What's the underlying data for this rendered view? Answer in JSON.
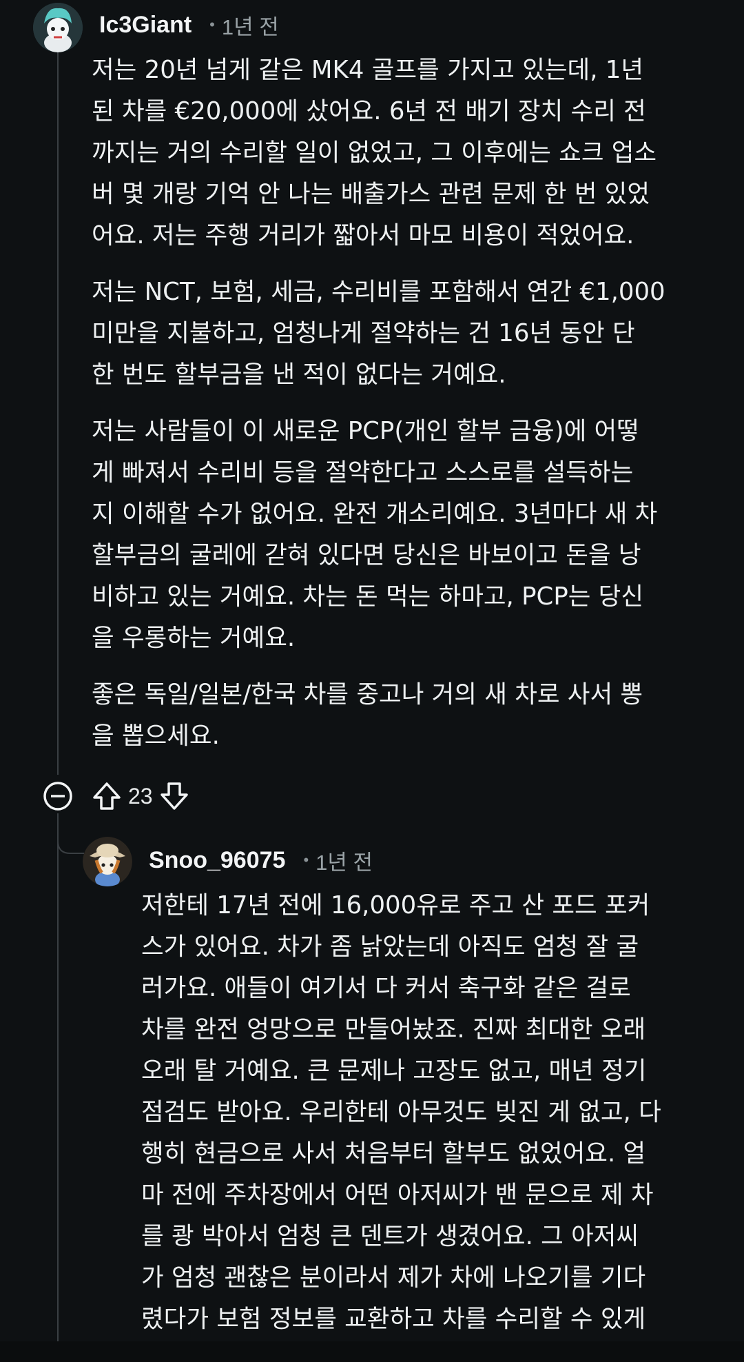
{
  "comments": [
    {
      "author": "Ic3Giant",
      "age": "1년 전",
      "paragraphs": [
        [
          "저는 20년 넘게 같은 MK4 골프를 가지고 있는데, 1년",
          "된 차를 €20,000에 샀어요. 6년 전 배기 장치 수리 전",
          "까지는 거의 수리할 일이 없었고, 그 이후에는 쇼크 업소",
          "버 몇 개랑 기억 안 나는 배출가스 관련 문제 한 번 있었",
          "어요. 저는 주행 거리가 짧아서 마모 비용이 적었어요."
        ],
        [
          "저는 NCT, 보험, 세금, 수리비를 포함해서 연간 €1,000",
          "미만을 지불하고, 엄청나게 절약하는 건 16년 동안 단",
          "한 번도 할부금을 낸 적이 없다는 거예요."
        ],
        [
          "저는 사람들이 이 새로운 PCP(개인 할부 금융)에 어떻",
          "게 빠져서 수리비 등을 절약한다고 스스로를 설득하는",
          "지 이해할 수가 없어요. 완전 개소리예요. 3년마다 새 차",
          "할부금의 굴레에 갇혀 있다면 당신은 바보이고 돈을 낭",
          "비하고 있는 거예요. 차는 돈 먹는 하마고, PCP는 당신",
          "을 우롱하는 거예요."
        ],
        [
          "좋은 독일/일본/한국 차를 중고나 거의 새 차로 사서 뽕",
          "을 뽑으세요."
        ]
      ],
      "votes": "23"
    },
    {
      "author": "Snoo_96075",
      "age": "1년 전",
      "paragraphs": [
        [
          "저한테 17년 전에 16,000유로 주고 산 포드 포커",
          "스가 있어요. 차가 좀 낡았는데 아직도 엄청 잘 굴",
          "러가요. 애들이 여기서 다 커서 축구화 같은 걸로",
          "차를 완전 엉망으로 만들어놨죠. 진짜 최대한 오래",
          "오래 탈 거예요. 큰 문제나 고장도 없고, 매년 정기",
          "점검도 받아요. 우리한테 아무것도 빚진 게 없고, 다",
          "행히 현금으로 사서 처음부터 할부도 없었어요. 얼",
          "마 전에 주차장에서 어떤 아저씨가 밴 문으로 제 차",
          "를 쾅 박아서 엄청 큰 덴트가 생겼어요. 그 아저씨",
          "가 엄청 괜찮은 분이라서 제가 차에 나오기를 기다",
          "렸다가 보험 정보를 교환하고 차를 수리할 수 있게"
        ]
      ]
    }
  ]
}
